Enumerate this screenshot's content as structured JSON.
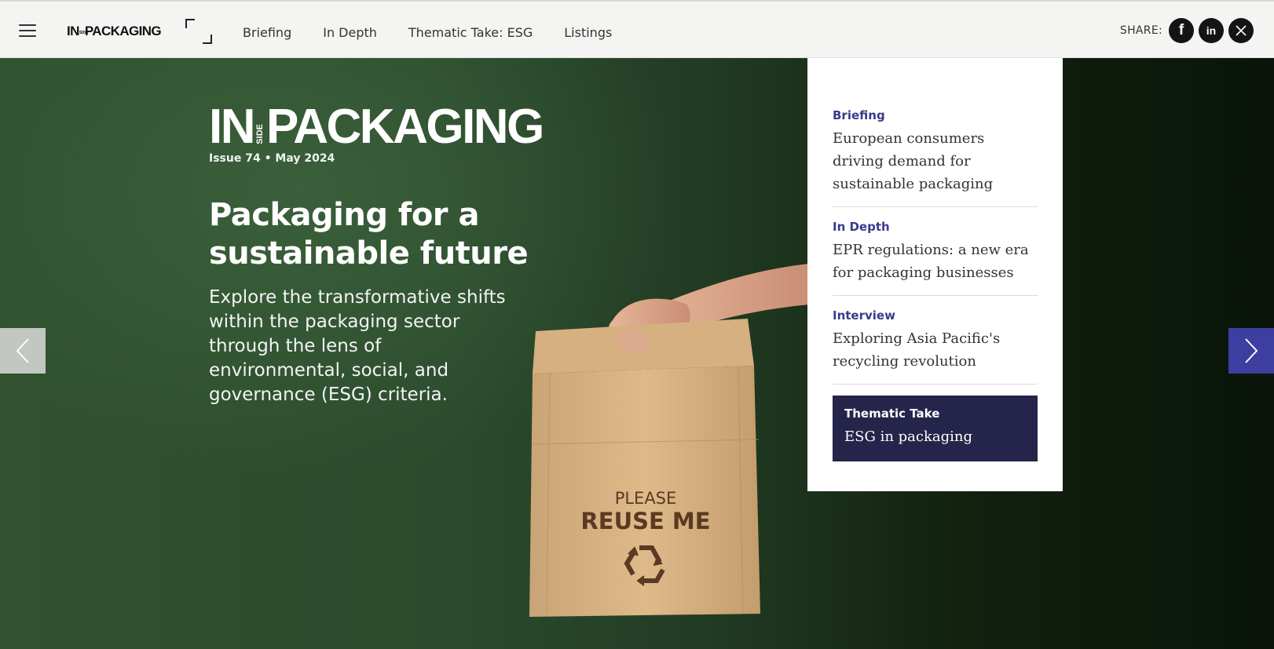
{
  "topbar": {
    "brand": {
      "in": "IN",
      "side": "SIDE",
      "rest": "PACKAGING"
    },
    "nav": [
      {
        "label": "Briefing"
      },
      {
        "label": "In Depth"
      },
      {
        "label": "Thematic Take: ESG"
      },
      {
        "label": "Listings"
      }
    ],
    "share": {
      "label": "SHARE:",
      "buttons": [
        {
          "icon": "facebook-icon",
          "glyph": "f"
        },
        {
          "icon": "linkedin-icon",
          "glyph": "in"
        },
        {
          "icon": "x-icon",
          "glyph": "𝕏"
        }
      ]
    }
  },
  "hero": {
    "brand": {
      "in": "IN",
      "side": "SIDE",
      "rest": "PACKAGING"
    },
    "issue": "Issue 74 • May 2024",
    "title": "Packaging for a sustainable future",
    "description": "Explore the transformative shifts within the packaging sector through the lens of environmental, social, and governance (ESG) criteria.",
    "bag": {
      "line1": "PLEASE",
      "line2": "REUSE ME"
    }
  },
  "panel": {
    "items": [
      {
        "category": "Briefing",
        "title": "European consumers driving demand for sustainable packaging"
      },
      {
        "category": "In Depth",
        "title": "EPR regulations: a new era for packaging businesses"
      },
      {
        "category": "Interview",
        "title": "Exploring Asia Pacific's recycling revolution"
      }
    ],
    "feature": {
      "category": "Thematic Take",
      "title": "ESG in packaging"
    }
  },
  "colors": {
    "accent": "#3c3f9f",
    "feature_bg": "#25244a",
    "category_text": "#3a3a8c",
    "hero_green": "#2b4b2c"
  }
}
